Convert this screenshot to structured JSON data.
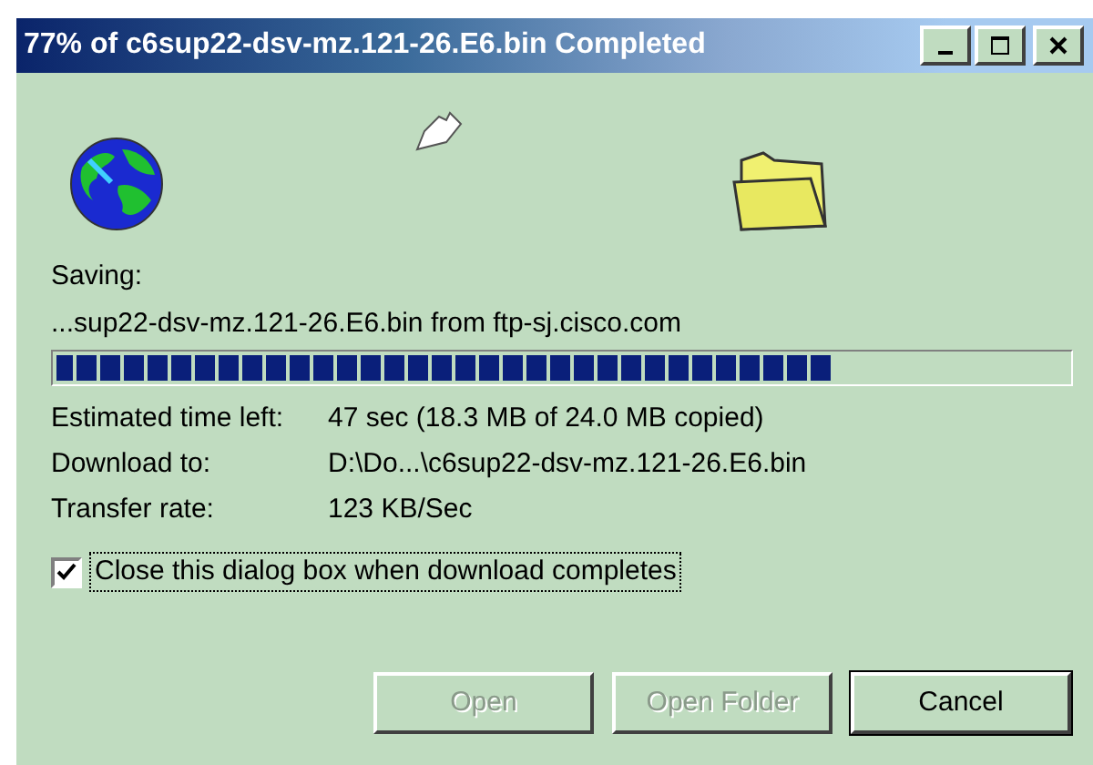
{
  "window": {
    "title": "77% of c6sup22-dsv-mz.121-26.E6.bin Completed",
    "controls": [
      {
        "kind": "minimize"
      },
      {
        "kind": "maximize"
      },
      {
        "kind": "close"
      }
    ]
  },
  "saving_label": "Saving:",
  "source": "...sup22-dsv-mz.121-26.E6.bin from ftp-sj.cisco.com",
  "progress": {
    "level": 0.77
  },
  "details": [
    {
      "label": "Estimated time left:",
      "value": "47 sec (18.3 MB of 24.0 MB copied)"
    },
    {
      "label": "Download to:",
      "value": "D:\\Do...\\c6sup22-dsv-mz.121-26.E6.bin"
    },
    {
      "label": "Transfer rate:",
      "value": "123 KB/Sec"
    }
  ],
  "close_when_done": {
    "label": "Close this dialog box when download completes",
    "checked": true
  },
  "buttons": [
    {
      "label": "Open",
      "disabled": true,
      "default": false
    },
    {
      "label": "Open Folder",
      "disabled": true,
      "default": false
    },
    {
      "label": "Cancel",
      "disabled": false,
      "default": true
    }
  ]
}
